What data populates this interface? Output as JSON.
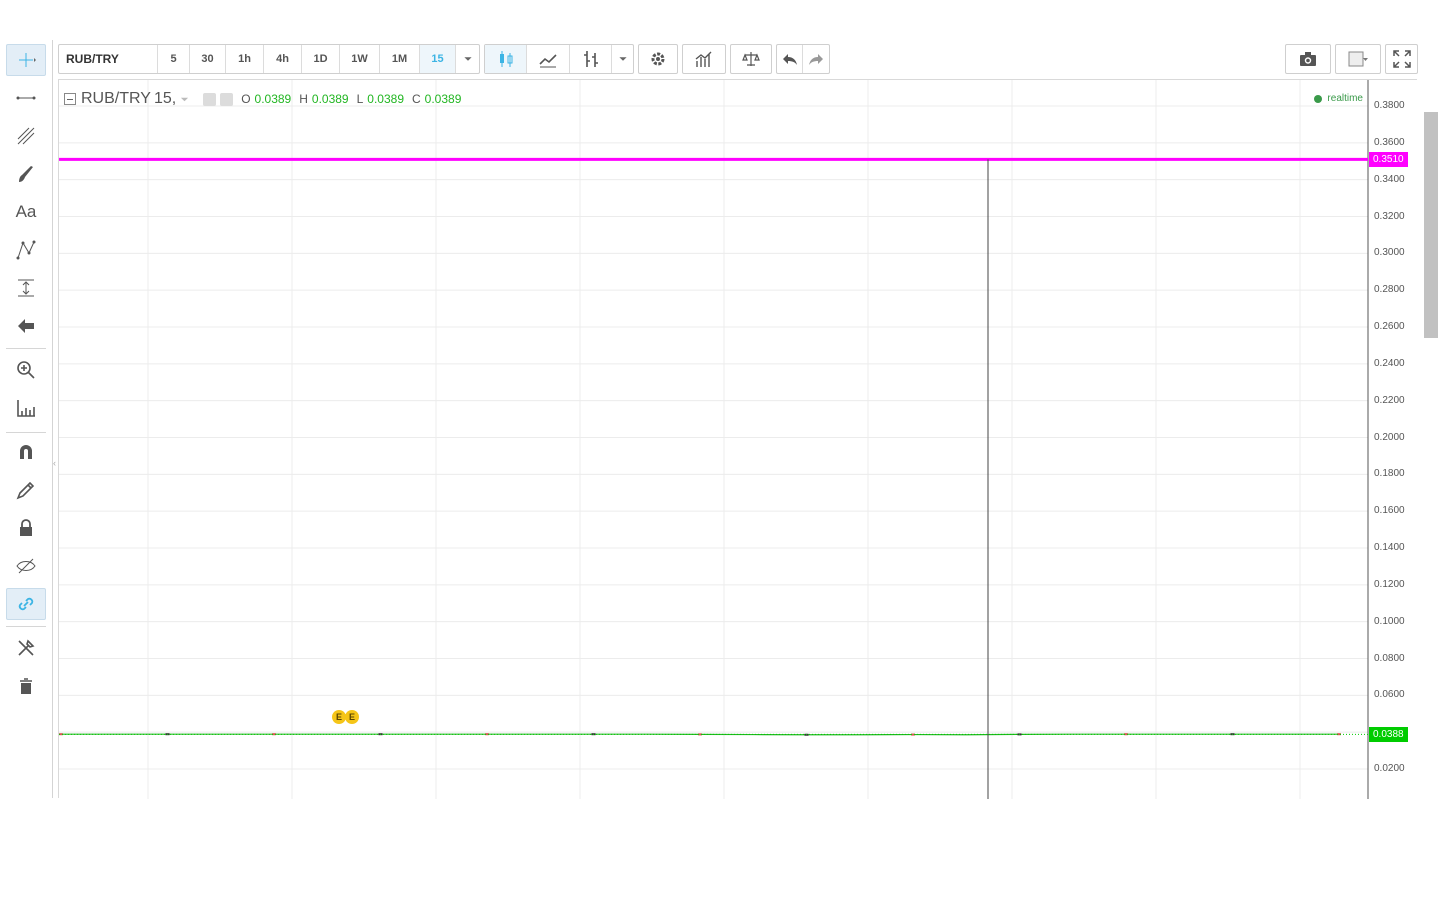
{
  "toolbar": {
    "symbol": "RUB/TRY",
    "intervals": [
      "5",
      "30",
      "1h",
      "4h",
      "1D",
      "1W",
      "1M"
    ],
    "active_interval": "15",
    "icons": [
      "candles-icon",
      "area-chart-icon",
      "bars-icon",
      "dropdown-caret-icon",
      "settings-gear-icon",
      "indicators-icon",
      "compare-scales-icon",
      "undo-icon",
      "redo-icon"
    ],
    "right_icons": [
      "camera-icon",
      "layout-square-icon",
      "fullscreen-icon"
    ]
  },
  "left_tools": [
    "crosshair-icon",
    "trend-line-icon",
    "pitchfork-icon",
    "brush-icon",
    "text-tool-icon",
    "pattern-icon",
    "measure-icon",
    "arrow-back-icon",
    "zoom-in-icon",
    "ruler-icon",
    "magnet-icon",
    "stay-drawing-icon",
    "lock-icon",
    "hide-icon",
    "link-icon",
    "remove-tools-icon",
    "trash-icon"
  ],
  "left_text_tool": "Aa",
  "legend": {
    "symbol": "RUB/TRY",
    "interval": "15,",
    "o_label": "O",
    "o": "0.0389",
    "h_label": "H",
    "h": "0.0389",
    "l_label": "L",
    "l": "0.0389",
    "c_label": "C",
    "c": "0.0389"
  },
  "realtime_label": "realtime",
  "earnings_markers": [
    "E",
    "E"
  ],
  "colors": {
    "accent": "#3cb4e4",
    "horizontal_line": "#ff00ff",
    "last_price": "#00cc00",
    "up": "#22b622",
    "grid": "#ececec"
  },
  "chart_data": {
    "type": "line",
    "ylim": [
      0.01,
      0.39
    ],
    "y_ticks": [
      "0.3800",
      "0.3600",
      "0.3400",
      "0.3200",
      "0.3000",
      "0.2800",
      "0.2600",
      "0.2400",
      "0.2200",
      "0.2000",
      "0.1800",
      "0.1600",
      "0.1400",
      "0.1200",
      "0.1000",
      "0.0800",
      "0.0600",
      "0.0200"
    ],
    "y_tick_values": [
      0.38,
      0.36,
      0.34,
      0.32,
      0.3,
      0.28,
      0.26,
      0.24,
      0.22,
      0.2,
      0.18,
      0.16,
      0.14,
      0.12,
      0.1,
      0.08,
      0.06,
      0.02
    ],
    "horizontal_line": {
      "value": 0.351,
      "label": "0.3510"
    },
    "last_price": {
      "value": 0.0388,
      "label": "0.0388"
    },
    "series": [
      {
        "values": [
          0.0389,
          0.0389,
          0.0389,
          0.0389,
          0.0389,
          0.0389,
          0.0389,
          0.0389,
          0.0389,
          0.0389,
          0.0389,
          0.0389,
          0.0388,
          0.0387,
          0.0386,
          0.0386,
          0.0387,
          0.0386,
          0.0388,
          0.0389,
          0.0389,
          0.0389,
          0.0389,
          0.0389,
          0.0389
        ]
      }
    ],
    "grid": true
  }
}
